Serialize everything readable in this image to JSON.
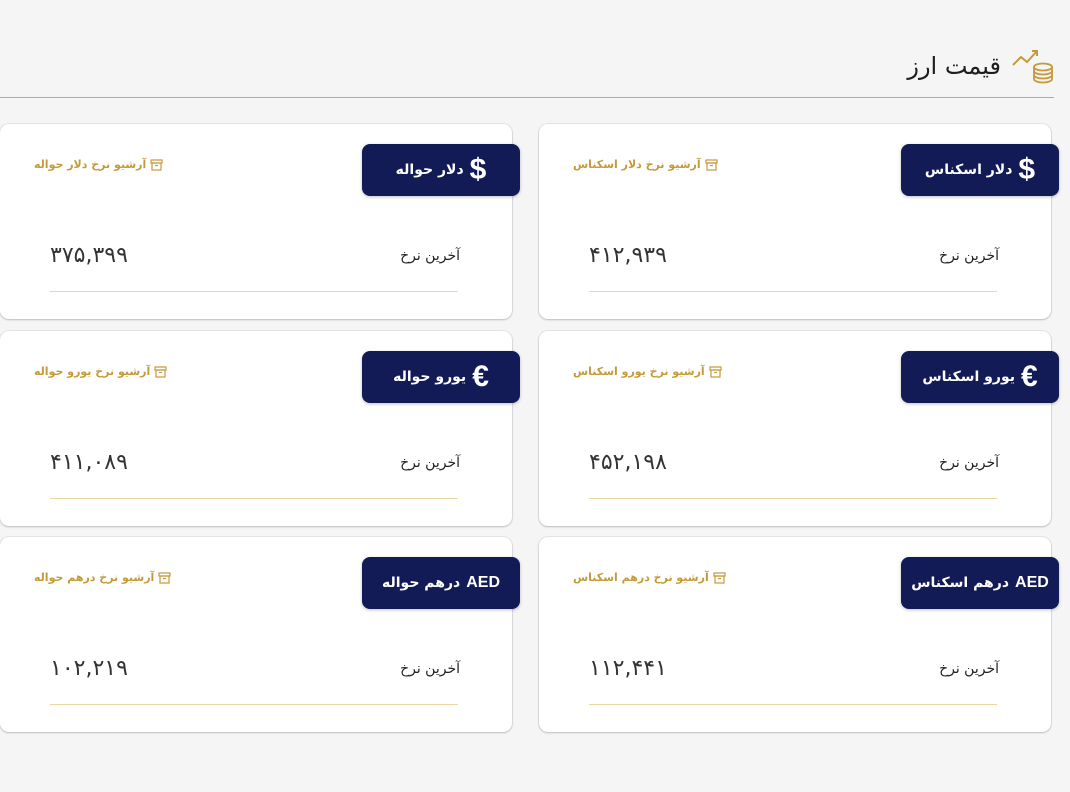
{
  "header": {
    "title": "قیمت ارز"
  },
  "colors": {
    "navy": "#121b56",
    "gold": "#c49a3a"
  },
  "cards": [
    {
      "badge_symbol": "$",
      "badge_label": "دلار اسکناس",
      "archive_label": "آرشیو نرخ دلار اسکناس",
      "rate_label": "آخرین نرخ",
      "rate_value": "۴۱۲,۹۳۹"
    },
    {
      "badge_symbol": "$",
      "badge_label": "دلار حواله",
      "archive_label": "آرشیو نرخ دلار حواله",
      "rate_label": "آخرین نرخ",
      "rate_value": "۳۷۵,۳۹۹"
    },
    {
      "badge_symbol": "€",
      "badge_label": "یورو اسکناس",
      "archive_label": "آرشیو نرخ یورو اسکناس",
      "rate_label": "آخرین نرخ",
      "rate_value": "۴۵۲,۱۹۸"
    },
    {
      "badge_symbol": "€",
      "badge_label": "یورو حواله",
      "archive_label": "آرشیو نرخ یورو حواله",
      "rate_label": "آخرین نرخ",
      "rate_value": "۴۱۱,۰۸۹"
    },
    {
      "badge_symbol": "AED",
      "badge_label": "درهم اسکناس",
      "archive_label": "آرشیو نرخ درهم اسکناس",
      "rate_label": "آخرین نرخ",
      "rate_value": "۱۱۲,۴۴۱"
    },
    {
      "badge_symbol": "AED",
      "badge_label": "درهم حواله",
      "archive_label": "آرشیو نرخ درهم حواله",
      "rate_label": "آخرین نرخ",
      "rate_value": "۱۰۲,۲۱۹"
    }
  ]
}
